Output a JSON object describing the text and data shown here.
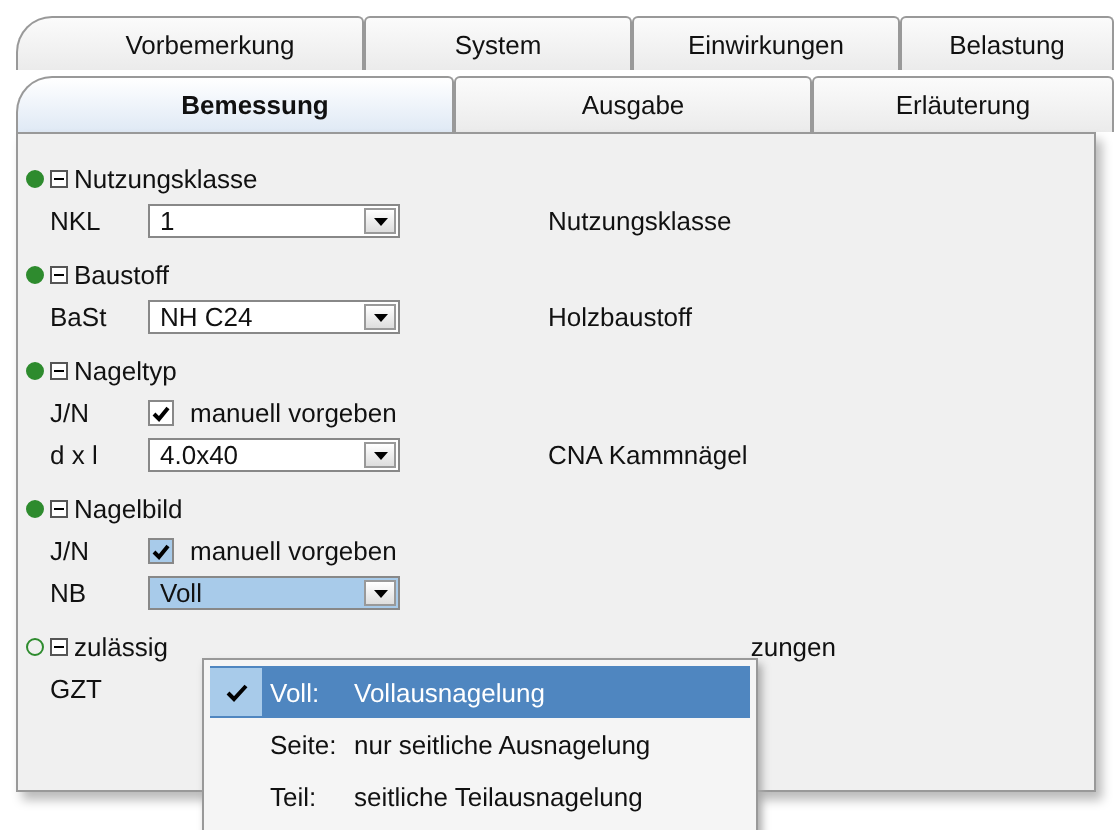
{
  "tab_rows": [
    [
      {
        "label": "Vorbemerkung",
        "selected": false
      },
      {
        "label": "System",
        "selected": false
      },
      {
        "label": "Einwirkungen",
        "selected": false
      },
      {
        "label": "Belastung",
        "selected": false
      }
    ],
    [
      {
        "label": "Bemessung",
        "selected": true
      },
      {
        "label": "Ausgabe",
        "selected": false
      },
      {
        "label": "Erläuterung",
        "selected": false
      }
    ]
  ],
  "sections": [
    {
      "title": "Nutzungsklasse",
      "complete": true,
      "expanded": true,
      "rows": [
        {
          "kind": "combo",
          "label": "NKL",
          "value": "1",
          "focused": false,
          "description": "Nutzungsklasse"
        }
      ]
    },
    {
      "title": "Baustoff",
      "complete": true,
      "expanded": true,
      "rows": [
        {
          "kind": "combo",
          "label": "BaSt",
          "value": "NH C24",
          "focused": false,
          "description": "Holzbaustoff"
        }
      ]
    },
    {
      "title": "Nageltyp",
      "complete": true,
      "expanded": true,
      "rows": [
        {
          "kind": "checkbox",
          "label": "J/N",
          "text": "manuell vorgeben",
          "checked": true,
          "focused": false
        },
        {
          "kind": "combo",
          "label": "d x l",
          "value": "4.0x40",
          "focused": false,
          "description": "CNA Kammnägel"
        }
      ]
    },
    {
      "title": "Nagelbild",
      "complete": true,
      "expanded": true,
      "rows": [
        {
          "kind": "checkbox",
          "label": "J/N",
          "text": "manuell vorgeben",
          "checked": true,
          "focused": true
        },
        {
          "kind": "combo",
          "label": "NB",
          "value": "Voll",
          "focused": true
        }
      ]
    },
    {
      "title": "zulässig",
      "title_tail": "zungen",
      "complete": false,
      "expanded": true,
      "rows": [
        {
          "kind": "label",
          "label": "GZT"
        }
      ]
    }
  ],
  "dropdown": {
    "items": [
      {
        "key": "Voll:",
        "text": "Vollausnagelung",
        "selected": true
      },
      {
        "key": "Seite:",
        "text": "nur seitliche Ausnagelung",
        "selected": false
      },
      {
        "key": "Teil:",
        "text": "seitliche Teilausnagelung",
        "selected": false
      }
    ]
  }
}
